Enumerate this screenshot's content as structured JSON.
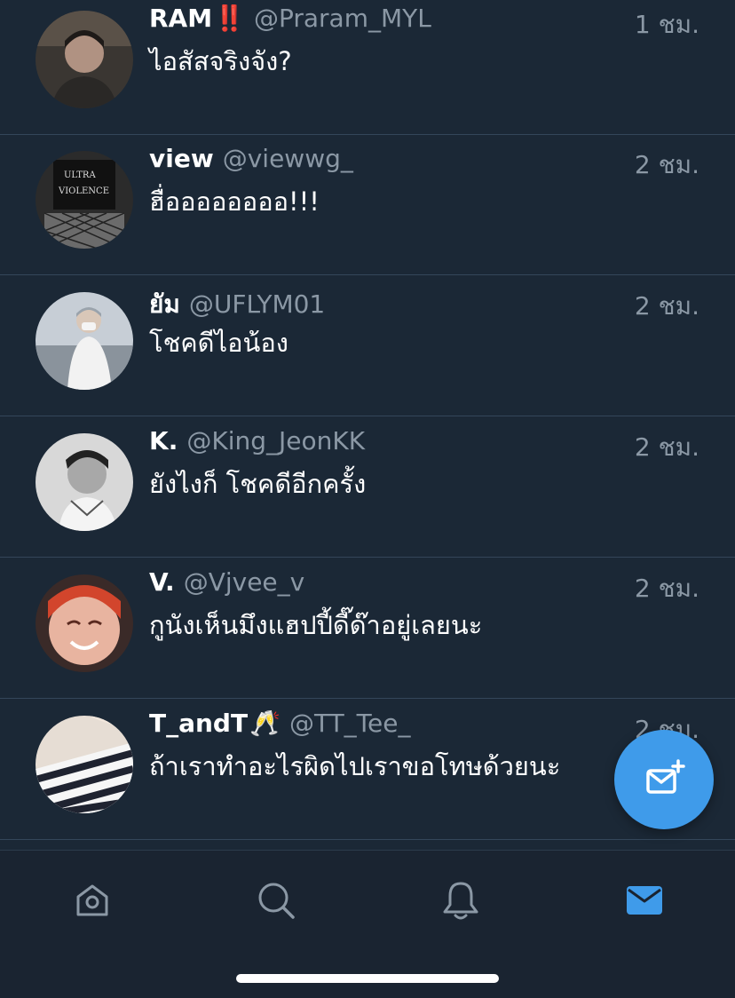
{
  "messages": [
    {
      "name": "RAM",
      "badge": "‼️",
      "handle": "@Praram_MYL",
      "time": "1 ชม.",
      "text": "ไอสัสจริงจัง?"
    },
    {
      "name": "view",
      "badge": "",
      "handle": "@viewwg_",
      "time": "2 ชม.",
      "text": "ฮื่ออออออออ!!!"
    },
    {
      "name": "ยัม",
      "badge": "",
      "handle": "@UFLYM01",
      "time": "2 ชม.",
      "text": "โชคดีไอน้อง"
    },
    {
      "name": "K.",
      "badge": "",
      "handle": "@King_JeonKK",
      "time": "2 ชม.",
      "text": "ยังไงก็ โชคดีอีกครั้ง"
    },
    {
      "name": "V.",
      "badge": "",
      "handle": "@Vjvee_v",
      "time": "2 ชม.",
      "text": "กูนังเห็นมึงแฮปปี้ดี๊ด๊าอยู่เลยนะ"
    },
    {
      "name": "T_andT",
      "badge": "🥂",
      "handle": "@TT_Tee_",
      "time": "2 ชม.",
      "text": "ถ้าเราทำอะไรผิดไปเราขอโทษด้วยนะ"
    }
  ],
  "tabs": [
    {
      "icon": "home-icon",
      "active": false
    },
    {
      "icon": "search-icon",
      "active": false
    },
    {
      "icon": "bell-icon",
      "active": false
    },
    {
      "icon": "mail-icon",
      "active": true
    }
  ],
  "fab": {
    "icon": "new-message-icon"
  },
  "colors": {
    "background": "#1b2836",
    "tabbar": "#1a2431",
    "accent": "#3f9bea",
    "secondary_text": "#8b98a5",
    "divider": "#34465a",
    "badge_red": "#e0245e"
  }
}
